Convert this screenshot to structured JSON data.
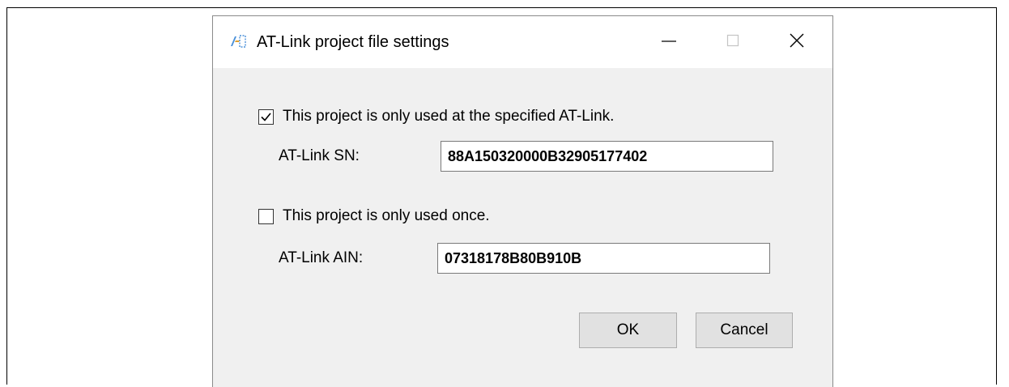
{
  "dialog": {
    "title": "AT-Link project file settings",
    "icon": "at-link-app-icon",
    "window_controls": {
      "minimize": "minimize-icon",
      "maximize": "maximize-icon",
      "close": "close-icon"
    }
  },
  "options": {
    "specified_link": {
      "label": "This project is only used at the specified AT-Link.",
      "checked": true
    },
    "used_once": {
      "label": "This project is only used once.",
      "checked": false
    }
  },
  "fields": {
    "sn": {
      "label": "AT-Link SN:",
      "value": "88A150320000B32905177402"
    },
    "ain": {
      "label": "AT-Link AIN:",
      "value": "07318178B80B910B"
    }
  },
  "buttons": {
    "ok": "OK",
    "cancel": "Cancel"
  },
  "colors": {
    "dialog_bg": "#f0f0f0",
    "titlebar_bg": "#ffffff",
    "icon_accent": "#3a7bd5"
  }
}
